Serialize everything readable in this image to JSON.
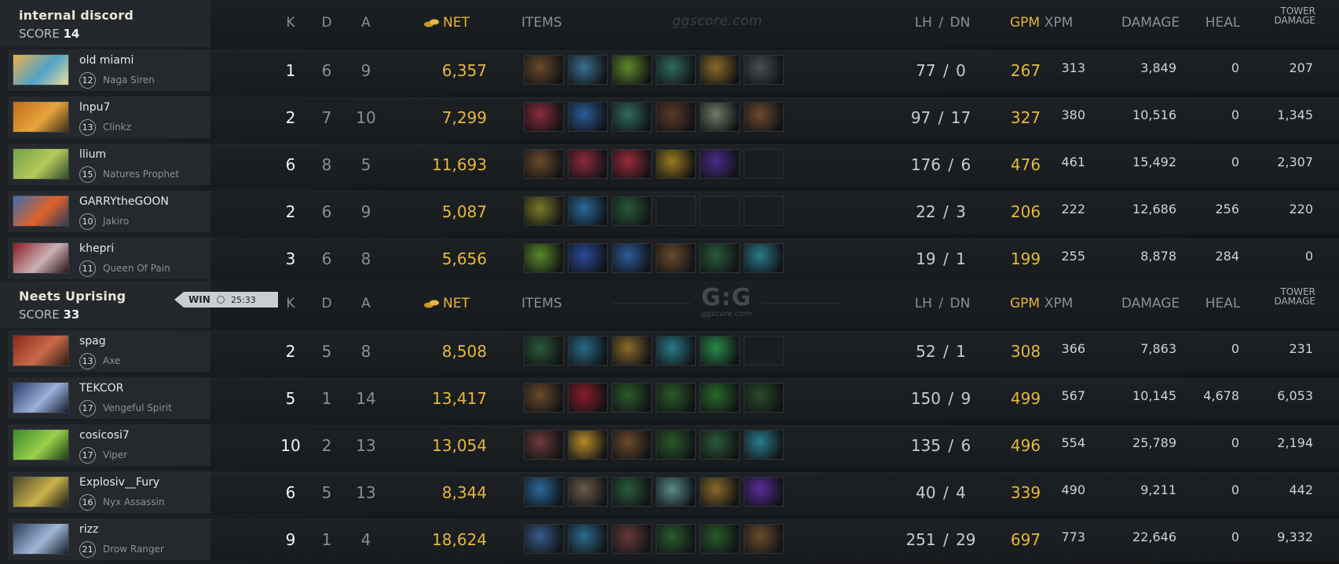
{
  "columns": {
    "k": "K",
    "d": "D",
    "a": "A",
    "net": "NET",
    "items": "ITEMS",
    "lhdn": "LH  /  DN",
    "gpm": "GPM",
    "xpm": "XPM",
    "damage": "DAMAGE",
    "heal": "HEAL",
    "tower_line1": "TOWER",
    "tower_line2": "DAMAGE"
  },
  "watermark": "ggscore.com",
  "logo": {
    "big": "G:G",
    "small": "ggscore.com"
  },
  "colors": {
    "gold": "#e6b83c",
    "panel": "#25292d",
    "background": "#14171a"
  },
  "teams": [
    {
      "name": "internal discord",
      "score_label": "SCORE",
      "score": "14",
      "players": [
        {
          "name": "old miami",
          "level": "12",
          "hero": "Naga Siren",
          "portrait": [
            "#f0b04a",
            "#4fa3c8",
            "#eedd99"
          ],
          "k": "1",
          "d": "6",
          "a": "9",
          "net": "6,357",
          "lh_dn": "77  /  0",
          "gpm": "267",
          "xpm": "313",
          "damage": "3,849",
          "heal": "0",
          "tower": "207",
          "items": [
            [
              "boots-item",
              "#6b4a2c"
            ],
            [
              "hammer-item",
              "#3a6f8e"
            ],
            [
              "drum-item",
              "#5f8a2a"
            ],
            [
              "staff-item",
              "#2f6b5c"
            ],
            [
              "flask-item",
              "#8a6a2a"
            ],
            [
              "ring-item",
              "#4a4e52"
            ]
          ]
        },
        {
          "name": "lnpu7",
          "level": "13",
          "hero": "Clinkz",
          "portrait": [
            "#c36a1c",
            "#e6a63c",
            "#3b2a1c"
          ],
          "k": "2",
          "d": "7",
          "a": "10",
          "net": "7,299",
          "lh_dn": "97  /  17",
          "gpm": "327",
          "xpm": "380",
          "damage": "10,516",
          "heal": "0",
          "tower": "1,345",
          "items": [
            [
              "mask-item",
              "#8a2a3c"
            ],
            [
              "potion-item",
              "#2a5c9a"
            ],
            [
              "staff-item",
              "#2f6b5c"
            ],
            [
              "hood-item",
              "#5c3a2a"
            ],
            [
              "mushroom-item",
              "#6e7a66"
            ],
            [
              "boots-item",
              "#6b4a2c"
            ]
          ]
        },
        {
          "name": "llium",
          "level": "15",
          "hero": "Natures Prophet",
          "portrait": [
            "#6fa24a",
            "#b7c95a",
            "#2c4a2a"
          ],
          "k": "6",
          "d": "8",
          "a": "5",
          "net": "11,693",
          "lh_dn": "176  /  6",
          "gpm": "476",
          "xpm": "461",
          "damage": "15,492",
          "heal": "0",
          "tower": "2,307",
          "items": [
            [
              "boots-item",
              "#6b4a2c"
            ],
            [
              "mask-item",
              "#8a2a3c"
            ],
            [
              "orb-item",
              "#9a2a3a"
            ],
            [
              "helm-item",
              "#9a7a1c"
            ],
            [
              "blade-item",
              "#4a2a8a"
            ],
            [
              "empty-slot",
              ""
            ]
          ]
        },
        {
          "name": "GARRYtheGOON",
          "level": "10",
          "hero": "Jakiro",
          "portrait": [
            "#3a6fb2",
            "#e0622a",
            "#2a3a5a"
          ],
          "k": "2",
          "d": "6",
          "a": "9",
          "net": "5,087",
          "lh_dn": "22  /  3",
          "gpm": "206",
          "xpm": "222",
          "damage": "12,686",
          "heal": "256",
          "tower": "220",
          "items": [
            [
              "flute-item",
              "#7a7a2a"
            ],
            [
              "scroll-item",
              "#2a6a9a"
            ],
            [
              "branch-item",
              "#2a5a3a"
            ],
            [
              "empty-slot",
              ""
            ],
            [
              "empty-slot",
              ""
            ],
            [
              "empty-slot",
              ""
            ]
          ]
        },
        {
          "name": "khepri",
          "level": "11",
          "hero": "Queen Of Pain",
          "portrait": [
            "#8a1c22",
            "#c9b0b4",
            "#2a1416"
          ],
          "k": "3",
          "d": "6",
          "a": "8",
          "net": "5,656",
          "lh_dn": "19  /  1",
          "gpm": "199",
          "xpm": "255",
          "damage": "8,878",
          "heal": "284",
          "tower": "0",
          "items": [
            [
              "pouch-item",
              "#5a8a2a"
            ],
            [
              "vortex-item",
              "#2a4a9a"
            ],
            [
              "potion-item",
              "#2a5c9a"
            ],
            [
              "boots-item",
              "#6b4a2c"
            ],
            [
              "branch-item",
              "#2a5a3a"
            ],
            [
              "wind-item",
              "#2a7a8a"
            ]
          ]
        }
      ]
    },
    {
      "name": "Neets Uprising",
      "score_label": "SCORE",
      "score": "33",
      "result": "WIN",
      "duration": "25:33",
      "players": [
        {
          "name": "spag",
          "level": "13",
          "hero": "Axe",
          "portrait": [
            "#8a2a1c",
            "#c96a4a",
            "#2a1a14"
          ],
          "k": "2",
          "d": "5",
          "a": "8",
          "net": "8,508",
          "lh_dn": "52  /  1",
          "gpm": "308",
          "xpm": "366",
          "damage": "7,863",
          "heal": "0",
          "tower": "231",
          "items": [
            [
              "branch-item",
              "#2a5a3a"
            ],
            [
              "blade-item",
              "#2a6a8a"
            ],
            [
              "flask-item",
              "#8a6a2a"
            ],
            [
              "wind-item",
              "#2a7a8a"
            ],
            [
              "cloak-item",
              "#2a8a4a"
            ],
            [
              "empty-slot",
              ""
            ]
          ]
        },
        {
          "name": "TEKCOR",
          "level": "17",
          "hero": "Vengeful Spirit",
          "portrait": [
            "#2a3a6a",
            "#9ab0d8",
            "#141a2a"
          ],
          "k": "5",
          "d": "1",
          "a": "14",
          "net": "13,417",
          "lh_dn": "150  /  9",
          "gpm": "499",
          "xpm": "567",
          "damage": "10,145",
          "heal": "4,678",
          "tower": "6,053",
          "items": [
            [
              "boots-item",
              "#6b4a2c"
            ],
            [
              "claw-item",
              "#8a1c2a"
            ],
            [
              "wraith-item",
              "#2a5a2a"
            ],
            [
              "wraith-item",
              "#2a5a2a"
            ],
            [
              "hood-item",
              "#2a6a2a"
            ],
            [
              "dagger-item",
              "#2a4a2a"
            ]
          ]
        },
        {
          "name": "cosicosi7",
          "level": "17",
          "hero": "Viper",
          "portrait": [
            "#3a8a2a",
            "#9ad04a",
            "#1a3a14"
          ],
          "k": "10",
          "d": "2",
          "a": "13",
          "net": "13,054",
          "lh_dn": "135  /  6",
          "gpm": "496",
          "xpm": "554",
          "damage": "25,789",
          "heal": "0",
          "tower": "2,194",
          "items": [
            [
              "axe-item",
              "#6a3a3a"
            ],
            [
              "gem-item",
              "#b58a2a"
            ],
            [
              "boots-item",
              "#6b4a2c"
            ],
            [
              "wraith-item",
              "#2a5a2a"
            ],
            [
              "branch-item",
              "#2a5a3a"
            ],
            [
              "wind-item",
              "#2a7a8a"
            ]
          ]
        },
        {
          "name": "Explosiv__Fury",
          "level": "16",
          "hero": "Nyx Assassin",
          "portrait": [
            "#4a4a2a",
            "#c9b04a",
            "#1a1a14"
          ],
          "k": "6",
          "d": "5",
          "a": "13",
          "net": "8,344",
          "lh_dn": "40  /  4",
          "gpm": "339",
          "xpm": "490",
          "damage": "9,211",
          "heal": "0",
          "tower": "442",
          "items": [
            [
              "scroll-item",
              "#2a6a9a"
            ],
            [
              "hatchet-item",
              "#6a5a4a"
            ],
            [
              "branch-item",
              "#2a5a3a"
            ],
            [
              "feather-item",
              "#5a8a8a"
            ],
            [
              "flask-item",
              "#8a6a2a"
            ],
            [
              "orb-item",
              "#5a2a9a"
            ]
          ]
        },
        {
          "name": "rizz",
          "level": "21",
          "hero": "Drow Ranger",
          "portrait": [
            "#2a3a5a",
            "#a0b8d8",
            "#141a2a"
          ],
          "k": "9",
          "d": "1",
          "a": "4",
          "net": "18,624",
          "lh_dn": "251  /  29",
          "gpm": "697",
          "xpm": "773",
          "damage": "22,646",
          "heal": "0",
          "tower": "9,332",
          "items": [
            [
              "glaive-item",
              "#3a5a8a"
            ],
            [
              "blade-item",
              "#2a6a8a"
            ],
            [
              "axe-item",
              "#6a3a3a"
            ],
            [
              "wraith-item",
              "#2a5a2a"
            ],
            [
              "wraith-item",
              "#2a5a2a"
            ],
            [
              "boots-item",
              "#6b4a2c"
            ]
          ]
        }
      ]
    }
  ]
}
